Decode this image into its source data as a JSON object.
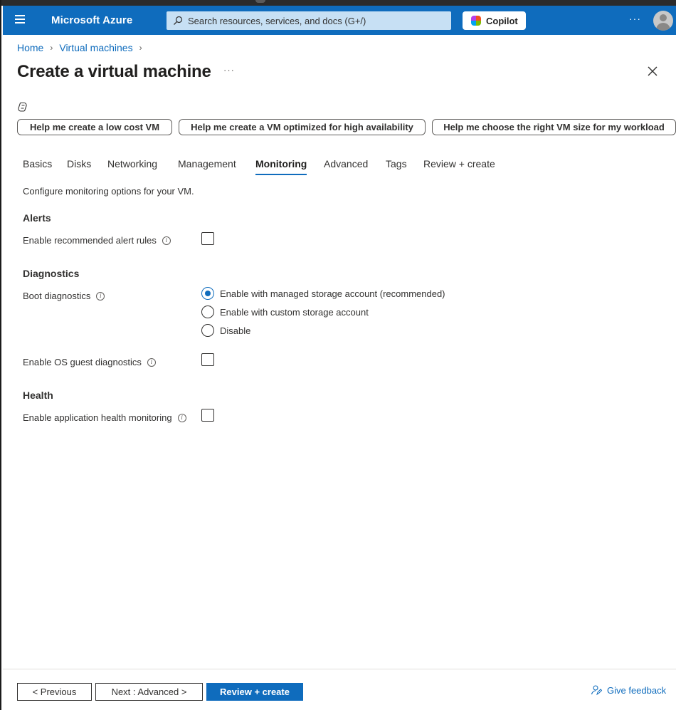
{
  "topbar": {
    "brand": "Microsoft Azure",
    "search_placeholder": "Search resources, services, and docs (G+/)",
    "copilot_label": "Copilot",
    "more_label": "···"
  },
  "breadcrumb": {
    "items": [
      "Home",
      "Virtual machines"
    ]
  },
  "page": {
    "title": "Create a virtual machine",
    "more_label": "···"
  },
  "suggestions": [
    "Help me create a low cost VM",
    "Help me create a VM optimized for high availability",
    "Help me choose the right VM size for my workload"
  ],
  "tabs": [
    {
      "label": "Basics",
      "active": false
    },
    {
      "label": "Disks",
      "active": false
    },
    {
      "label": "Networking",
      "active": false
    },
    {
      "label": "Management",
      "active": false
    },
    {
      "label": "Monitoring",
      "active": true
    },
    {
      "label": "Advanced",
      "active": false
    },
    {
      "label": "Tags",
      "active": false
    },
    {
      "label": "Review + create",
      "active": false
    }
  ],
  "monitoring": {
    "intro": "Configure monitoring options for your VM.",
    "alerts": {
      "heading": "Alerts",
      "recommended_alert_rules_label": "Enable recommended alert rules",
      "recommended_alert_rules_checked": false
    },
    "diagnostics": {
      "heading": "Diagnostics",
      "boot_label": "Boot diagnostics",
      "boot_options": [
        {
          "label": "Enable with managed storage account (recommended)",
          "selected": true
        },
        {
          "label": "Enable with custom storage account",
          "selected": false
        },
        {
          "label": "Disable",
          "selected": false
        }
      ],
      "os_guest_label": "Enable OS guest diagnostics",
      "os_guest_checked": false
    },
    "health": {
      "heading": "Health",
      "app_health_label": "Enable application health monitoring",
      "app_health_checked": false
    },
    "info_glyph": "i"
  },
  "footer": {
    "previous_label": "< Previous",
    "next_label": "Next : Advanced >",
    "review_label": "Review + create",
    "feedback_label": "Give feedback"
  },
  "colors": {
    "accent": "#0f6cbd",
    "search_bg": "#c7e0f4"
  }
}
